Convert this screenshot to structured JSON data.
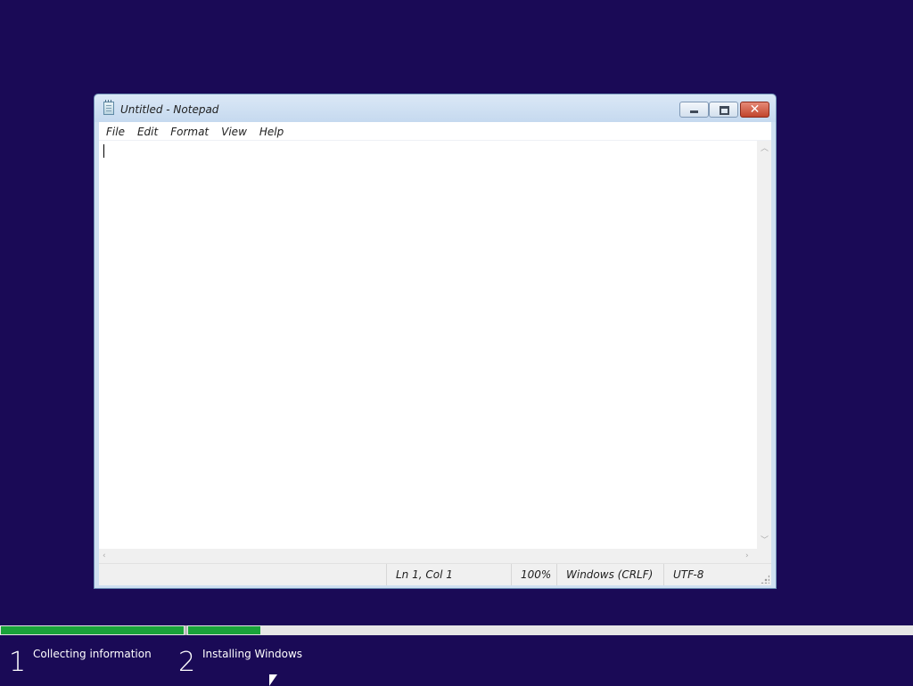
{
  "window": {
    "title": "Untitled - Notepad",
    "controls": {
      "minimize": "minimize",
      "maximize": "maximize",
      "close": "✕"
    }
  },
  "menu": {
    "items": [
      {
        "label": "File"
      },
      {
        "label": "Edit"
      },
      {
        "label": "Format"
      },
      {
        "label": "View"
      },
      {
        "label": "Help"
      }
    ]
  },
  "editor": {
    "content": ""
  },
  "status": {
    "position": "Ln 1, Col 1",
    "zoom": "100%",
    "line_ending": "Windows (CRLF)",
    "encoding": "UTF-8"
  },
  "setup": {
    "steps": [
      {
        "number": "1",
        "label": "Collecting information"
      },
      {
        "number": "2",
        "label": "Installing Windows"
      }
    ],
    "progress": {
      "step1_fraction": 1.0,
      "step2_fraction": 0.1
    },
    "colors": {
      "progress": "#1aa33a",
      "background": "#1a0a56"
    }
  },
  "icons": {
    "app": "notepad-icon",
    "scroll_up": "chevron-up-icon",
    "scroll_down": "chevron-down-icon",
    "scroll_left": "chevron-left-icon",
    "scroll_right": "chevron-right-icon",
    "grip": "resize-grip-icon",
    "cursor": "mouse-pointer-icon"
  }
}
